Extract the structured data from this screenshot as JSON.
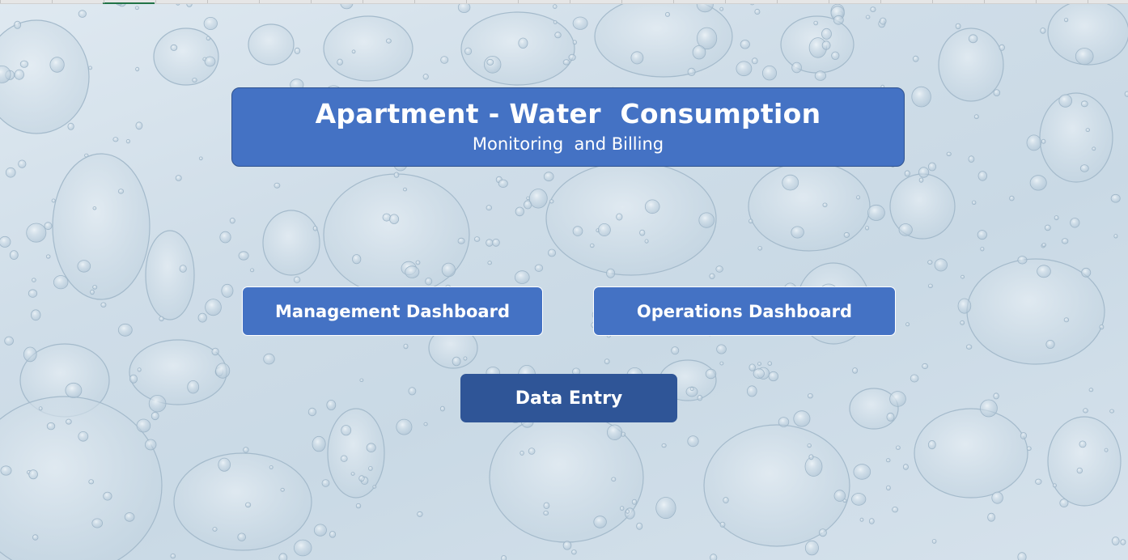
{
  "header": {
    "title": "Apartment - Water  Consumption",
    "subtitle": "Monitoring  and Billing"
  },
  "buttons": {
    "management_dashboard": "Management Dashboard",
    "operations_dashboard": "Operations Dashboard",
    "data_entry": "Data Entry"
  },
  "background": {
    "image": "water-droplets",
    "base_color": "#d3e0ea"
  },
  "colors": {
    "primary_button": "#4472c4",
    "dark_button": "#2f5597",
    "text": "#ffffff"
  }
}
